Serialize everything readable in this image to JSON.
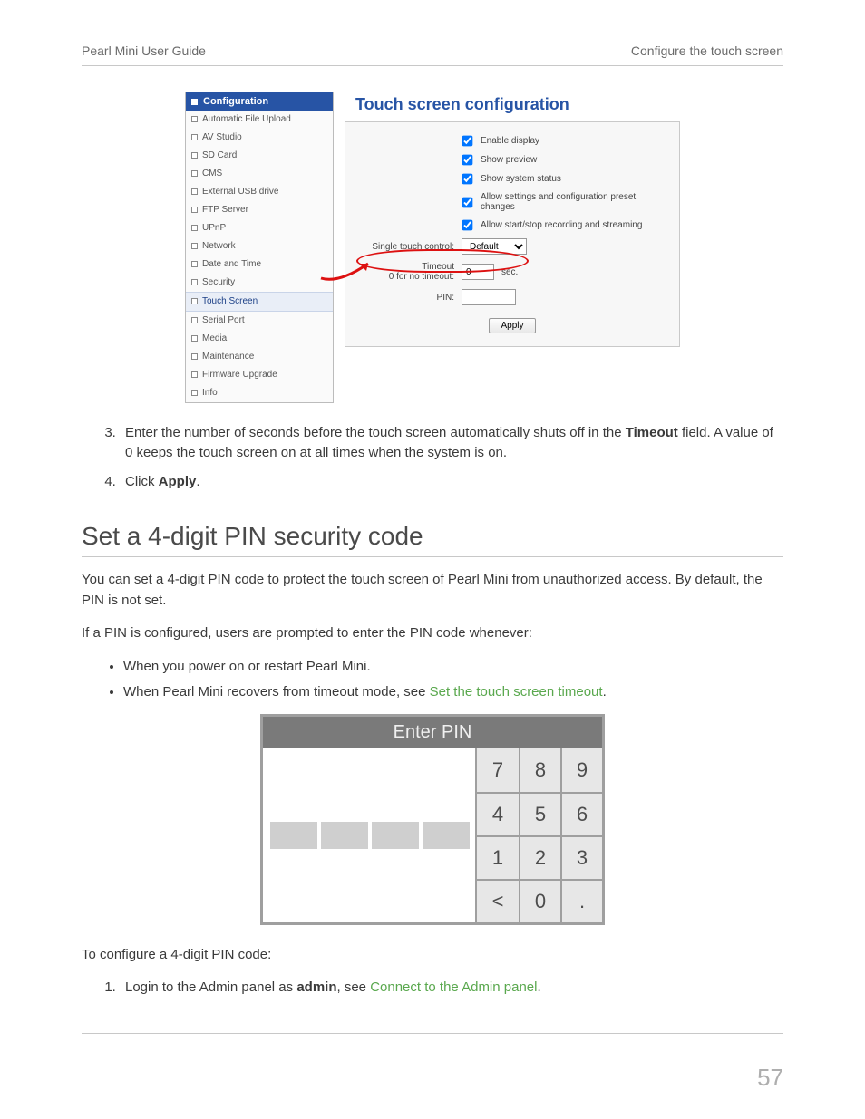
{
  "header": {
    "left": "Pearl Mini User Guide",
    "right": "Configure the touch screen"
  },
  "screenshot": {
    "sidebar": {
      "title": "Configuration",
      "items": [
        "Automatic File Upload",
        "AV Studio",
        "SD Card",
        "CMS",
        "External USB drive",
        "FTP Server",
        "UPnP",
        "Network",
        "Date and Time",
        "Security",
        "Touch Screen",
        "Serial Port",
        "Media",
        "Maintenance",
        "Firmware Upgrade",
        "Info"
      ],
      "active_index": 10
    },
    "panel": {
      "title": "Touch screen configuration",
      "checkboxes": [
        "Enable display",
        "Show preview",
        "Show system status",
        "Allow settings and configuration preset changes",
        "Allow start/stop recording and streaming"
      ],
      "single_touch_label": "Single touch control:",
      "single_touch_value": "Default",
      "timeout_label_line1": "Timeout",
      "timeout_label_line2": "0 for no timeout:",
      "timeout_value": "0",
      "timeout_suffix": "sec.",
      "pin_label": "PIN:",
      "pin_value": "",
      "apply": "Apply"
    }
  },
  "steps_a": {
    "item3": {
      "pre": "Enter the number of seconds before the touch screen automatically shuts off in the ",
      "bold": "Timeout",
      "post": " field. A value of 0 keeps the touch screen on at all times when the system is on."
    },
    "item4": {
      "pre": "Click ",
      "bold": "Apply",
      "post": "."
    }
  },
  "section_title": "Set a 4-digit PIN security code",
  "para1": "You can set a 4-digit PIN code to protect the touch screen of Pearl Mini from unauthorized access. By default, the PIN is not set.",
  "para2": "If a PIN is configured, users are prompted to enter the PIN code whenever:",
  "bullets": {
    "b1": "When you power on or restart Pearl Mini.",
    "b2_pre": "When Pearl Mini recovers from timeout mode, see ",
    "b2_link": "Set the touch screen timeout",
    "b2_post": "."
  },
  "pinpad": {
    "title": "Enter PIN",
    "keys": [
      [
        "7",
        "8",
        "9"
      ],
      [
        "4",
        "5",
        "6"
      ],
      [
        "1",
        "2",
        "3"
      ],
      [
        "<",
        "0",
        "."
      ]
    ]
  },
  "para3": "To configure a 4-digit PIN code:",
  "steps_b": {
    "item1_pre": "Login to the Admin panel as ",
    "item1_bold": "admin",
    "item1_mid": ", see ",
    "item1_link": "Connect to the Admin panel",
    "item1_post": "."
  },
  "page_number": "57"
}
